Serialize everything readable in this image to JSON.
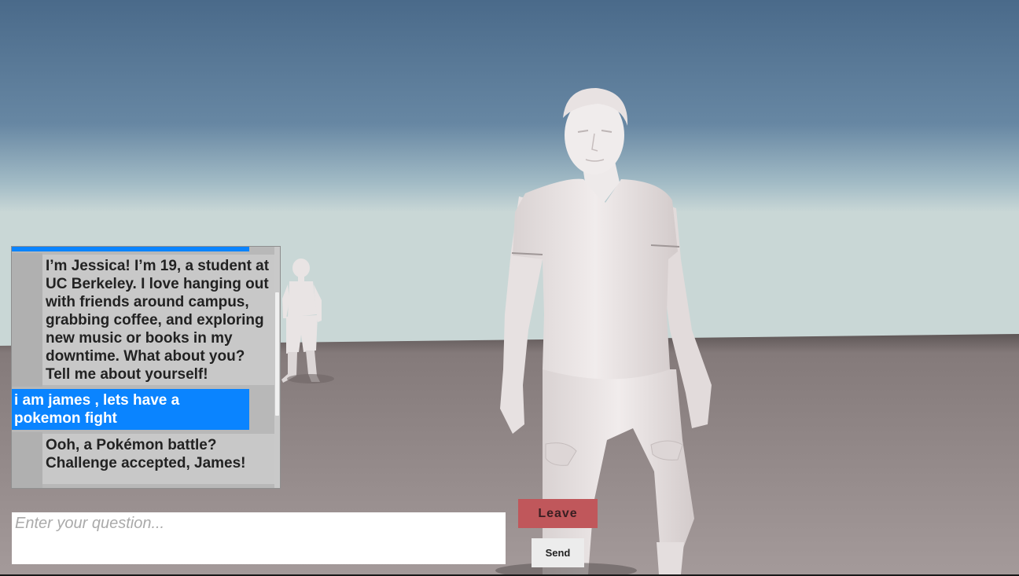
{
  "chat": {
    "messages": [
      {
        "role": "user",
        "text": ""
      },
      {
        "role": "assistant",
        "text": "I’m Jessica! I’m 19, a student at UC Berkeley. I love hanging out with friends around campus, grabbing coffee, and exploring new music or books in my downtime. What about you? Tell me about yourself!"
      },
      {
        "role": "user",
        "text": "i am james , lets have a pokemon fight"
      },
      {
        "role": "assistant",
        "text": "Ooh, a Pokémon battle? Challenge accepted, James!"
      }
    ]
  },
  "input": {
    "placeholder": "Enter your question...",
    "value": ""
  },
  "buttons": {
    "leave_label": "Leave",
    "send_label": "Send"
  },
  "colors": {
    "user_bubble": "#0a84ff",
    "assistant_bubble": "#c8c8c8",
    "leave_button": "#c0575b",
    "sky_top": "#4e6f8f",
    "ground": "#9a8f8f"
  }
}
